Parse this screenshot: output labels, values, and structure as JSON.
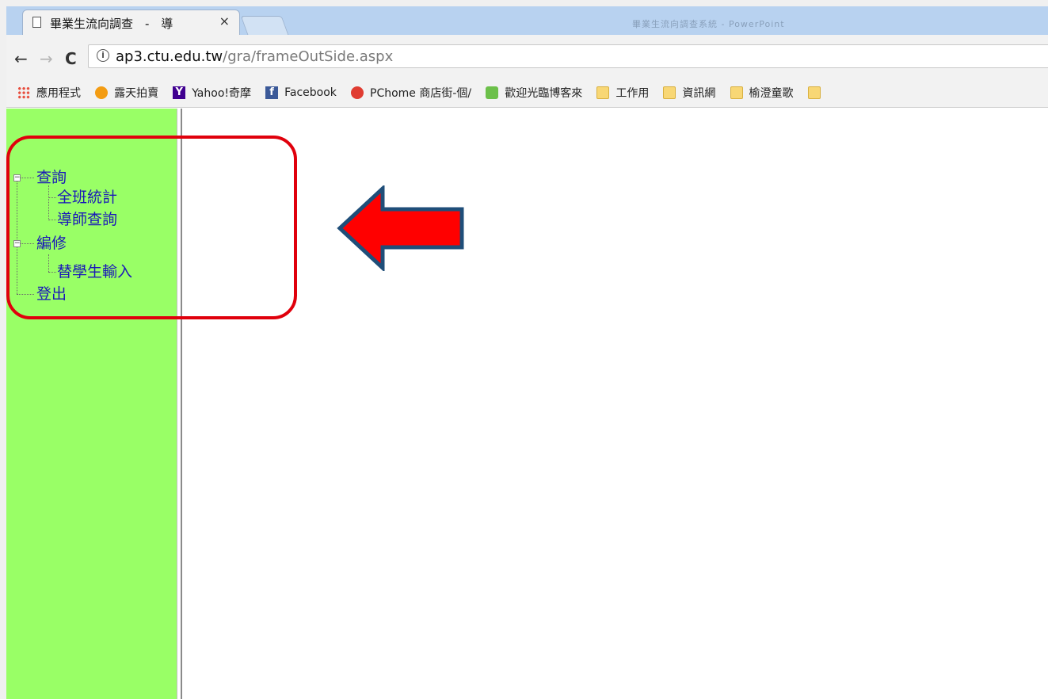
{
  "browser": {
    "tab_title": "畢業生流向調查　-　導",
    "close_glyph": "×",
    "window_title_faint": "畢業生流向調查系統 - PowerPoint",
    "url_host": "ap3.ctu.edu.tw",
    "url_path": "/gra/frameOutSide.aspx",
    "nav": {
      "back": "←",
      "forward": "→",
      "reload": "C"
    }
  },
  "bookmarks": [
    {
      "label": "應用程式",
      "icon": "apps-icon"
    },
    {
      "label": "露天拍賣",
      "icon": "ruten-icon"
    },
    {
      "label": "Yahoo!奇摩",
      "icon": "yahoo-icon"
    },
    {
      "label": "Facebook",
      "icon": "facebook-icon"
    },
    {
      "label": "PChome 商店街-個/",
      "icon": "pchome-icon"
    },
    {
      "label": "歡迎光臨博客來",
      "icon": "bookstore-icon"
    },
    {
      "label": "工作用",
      "icon": "folder-icon"
    },
    {
      "label": "資訊網",
      "icon": "folder-icon"
    },
    {
      "label": "榆澄童歌",
      "icon": "folder-icon"
    }
  ],
  "tree": {
    "query": "查詢",
    "class_stats": "全班統計",
    "tutor_query": "導師查詢",
    "edit": "編修",
    "student_input": "替學生輸入",
    "logout": "登出"
  },
  "colors": {
    "sidebar_bg": "#99ff66",
    "tree_link": "#1a18b8",
    "highlight": "#e0000c",
    "arrow_fill": "#ff0000",
    "arrow_stroke": "#1f4e79"
  }
}
